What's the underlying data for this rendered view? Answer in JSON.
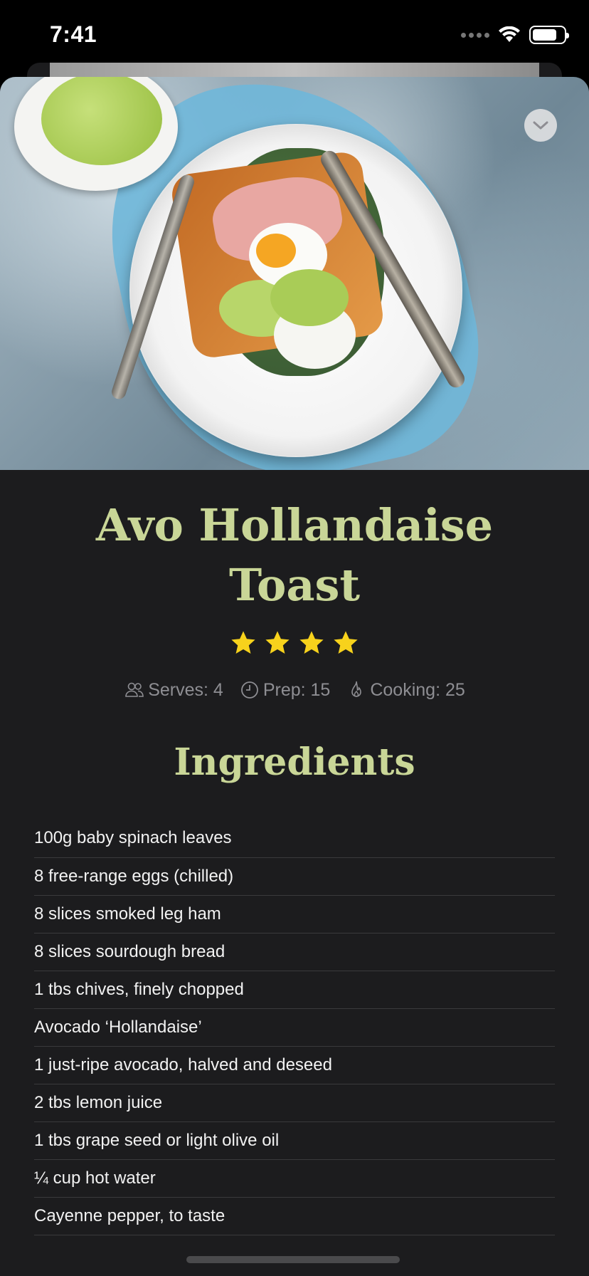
{
  "status_bar": {
    "time": "7:41"
  },
  "recipe": {
    "title": "Avo Hollandaise Toast",
    "rating": 4,
    "rating_max": 4,
    "serves": "Serves: 4",
    "prep": "Prep: 15",
    "cooking": "Cooking: 25"
  },
  "ingredients_section": {
    "title": "Ingredients",
    "items": [
      "100g baby spinach leaves",
      "8 free-range eggs (chilled)",
      "8 slices smoked leg ham",
      "8 slices sourdough bread",
      "1 tbs chives, finely chopped",
      "Avocado ‘Hollandaise’",
      "1 just-ripe avocado, halved and deseed",
      "2 tbs lemon juice",
      "1 tbs grape seed or light olive oil",
      "¼ cup hot water",
      "Cayenne pepper, to taste"
    ]
  },
  "colors": {
    "accent": "#c9d697",
    "star": "#f7d21c",
    "background": "#1c1c1e",
    "muted": "#8e8e93"
  },
  "icons": {
    "dismiss": "chevron-down-icon",
    "serves": "people-icon",
    "prep": "clock-icon",
    "cooking": "flame-icon",
    "rating": "star-icon"
  }
}
